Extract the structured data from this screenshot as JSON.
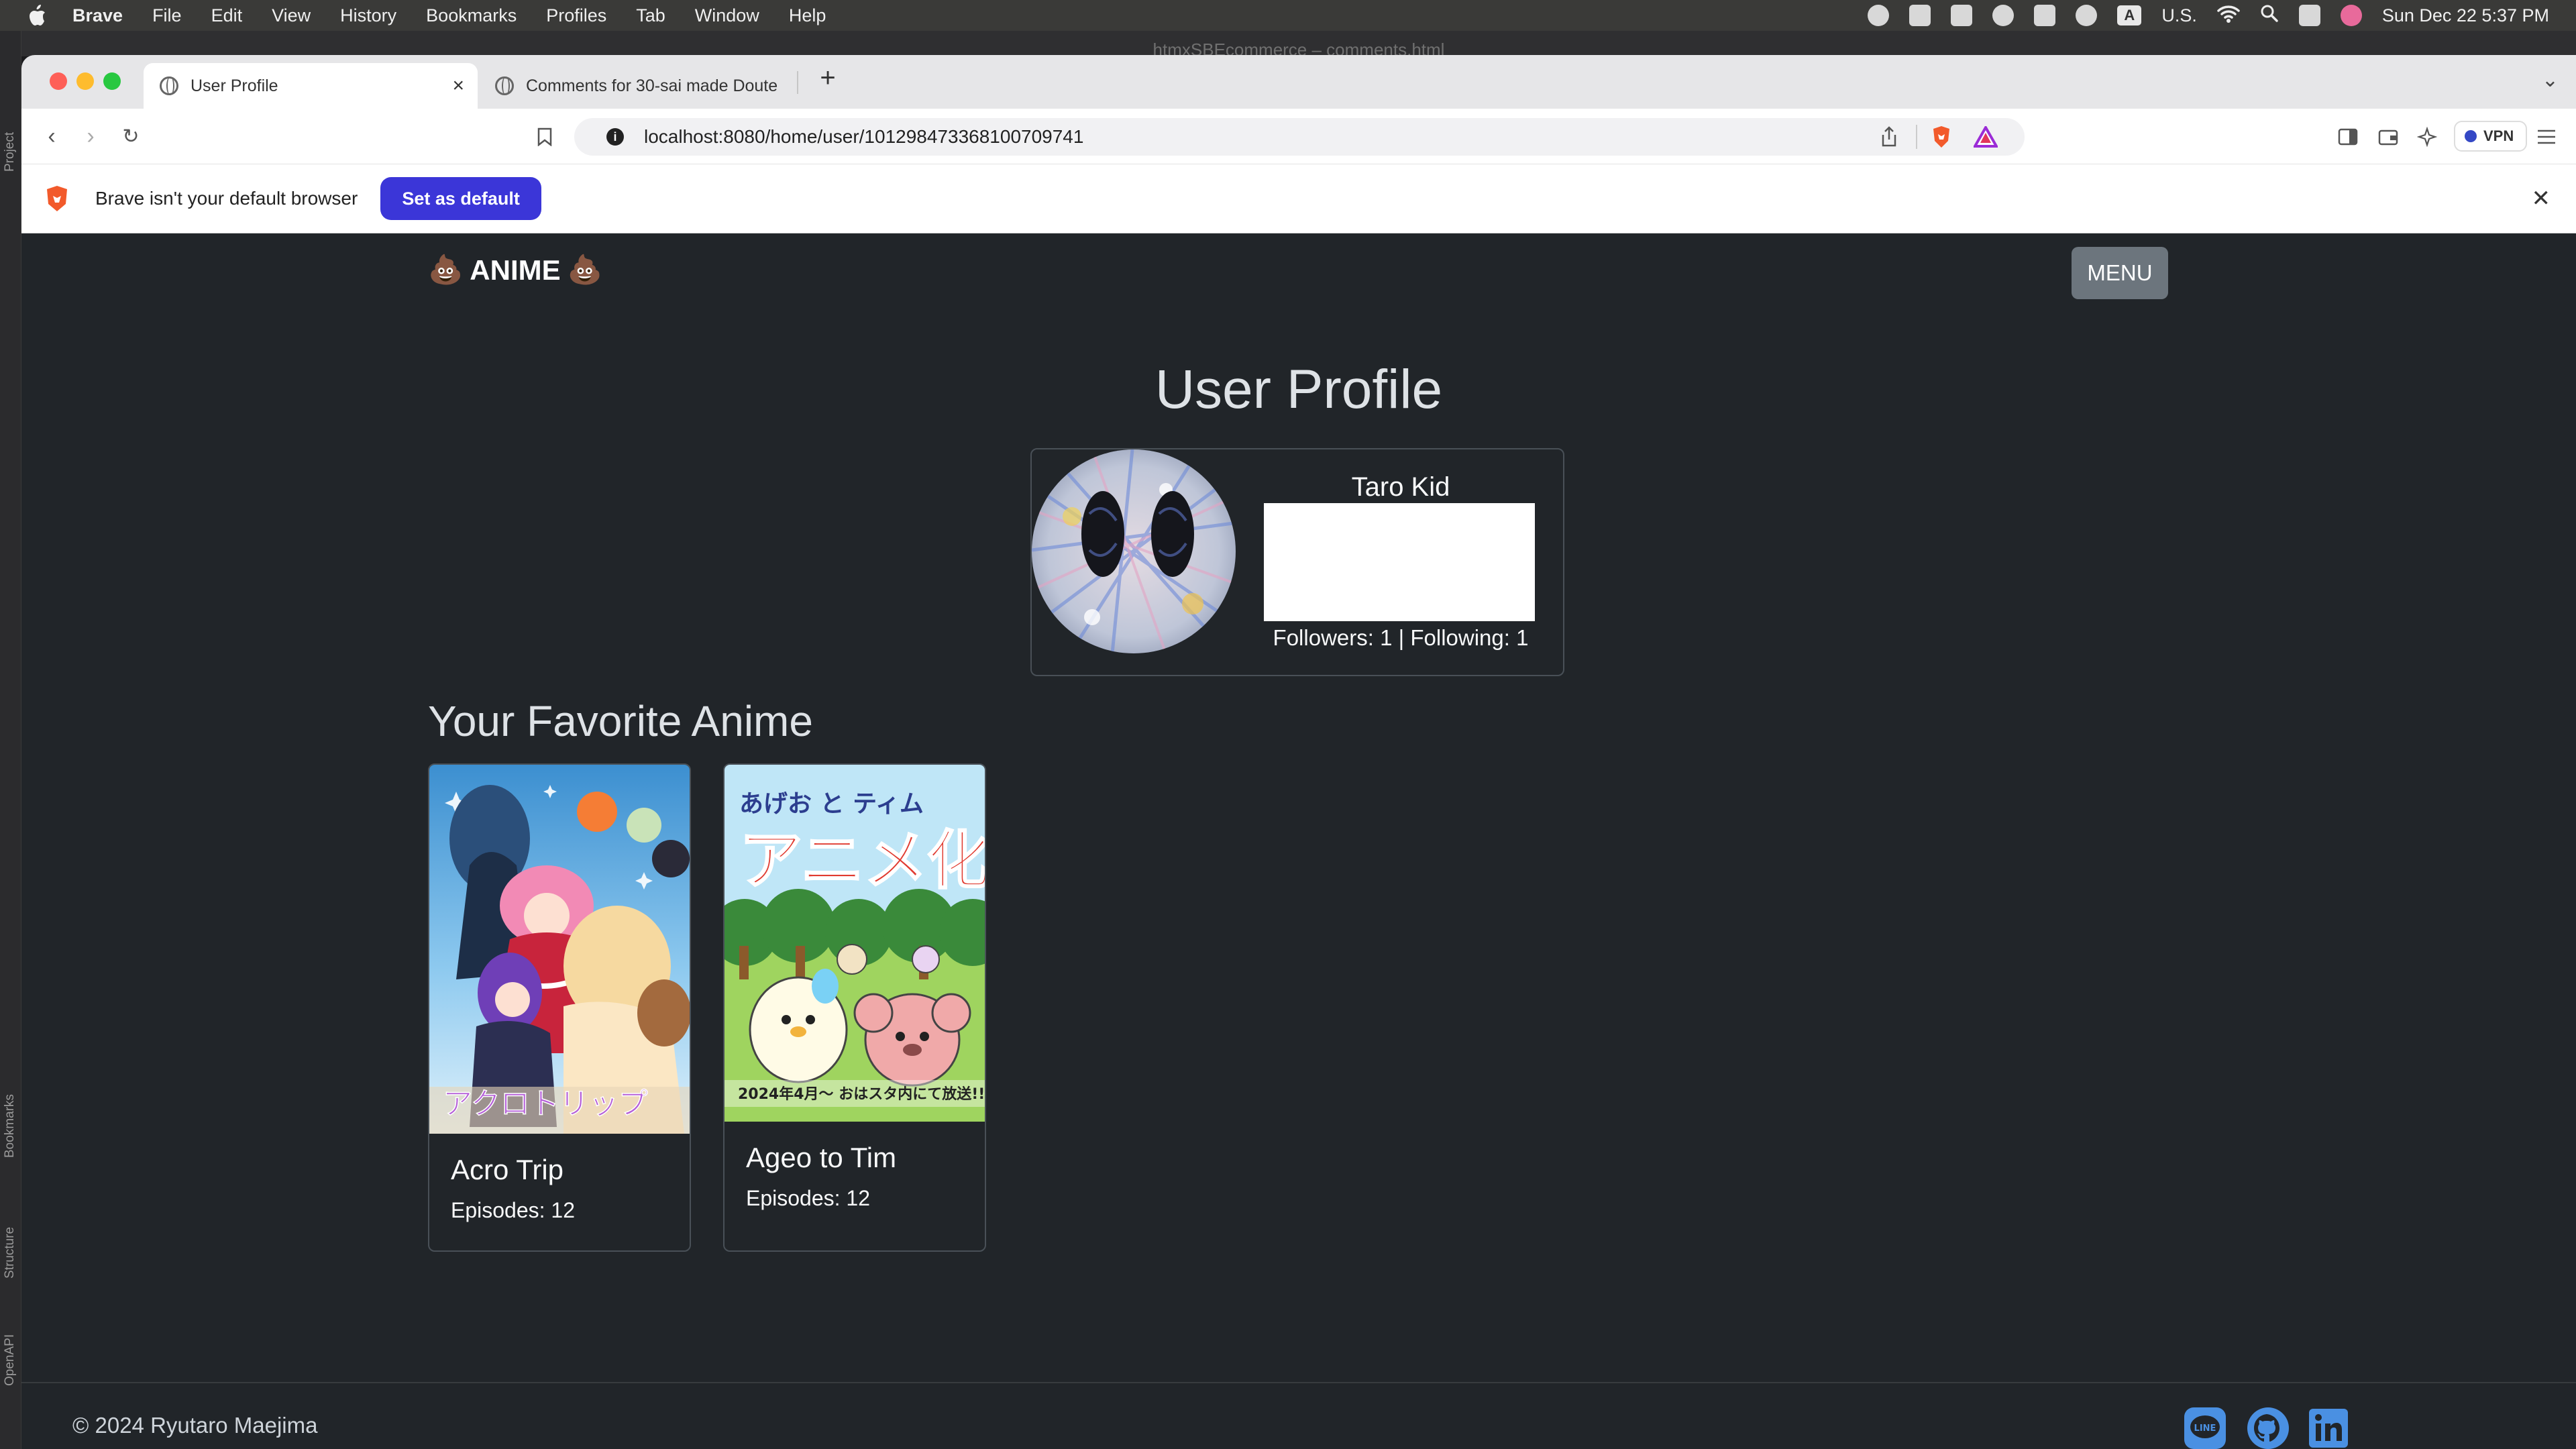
{
  "menubar": {
    "app": "Brave",
    "items": [
      "File",
      "Edit",
      "View",
      "History",
      "Bookmarks",
      "Profiles",
      "Tab",
      "Window",
      "Help"
    ],
    "input_source": "U.S.",
    "input_letter": "A",
    "datetime": "Sun Dec 22  5:37 PM"
  },
  "ide": {
    "window_title": "htmxSBEcommerce – comments.html",
    "side_labels": [
      "Project",
      "Bookmarks",
      "Structure",
      "OpenAPI"
    ]
  },
  "tabs": [
    {
      "title": "User Profile",
      "active": true
    },
    {
      "title": "Comments for 30-sai made Doute",
      "active": false
    }
  ],
  "address": {
    "url": "localhost:8080/home/user/101298473368100709741"
  },
  "toolbar": {
    "vpn_label": "VPN"
  },
  "infobar": {
    "message": "Brave isn't your default browser",
    "button": "Set as default"
  },
  "site": {
    "brand": "ANIME",
    "brand_emoji_left": "💩",
    "brand_emoji_right": "💩",
    "menu_button": "MENU"
  },
  "profile": {
    "page_title": "User Profile",
    "name": "Taro Kid",
    "stats": "Followers: 1 | Following: 1"
  },
  "favorites": {
    "heading": "Your Favorite Anime",
    "items": [
      {
        "title": "Acro Trip",
        "episodes": "Episodes: 12",
        "poster_caption": "アクロトリップ"
      },
      {
        "title": "Ageo to Tim",
        "episodes": "Episodes: 12",
        "poster_caption_top": "あげお と ティム",
        "poster_caption_main": "アニメ化",
        "poster_caption_bottom": "2024年4月〜 おはスタ内にて放送!!"
      }
    ]
  },
  "footer": {
    "copyright": "© 2024 Ryutaro Maejima",
    "social": [
      "line-icon",
      "github-icon",
      "linkedin-icon"
    ],
    "social_color": "#4a90e2"
  },
  "colors": {
    "page_bg": "#212529",
    "accent_button": "#3b36d8",
    "menu_button": "#6c757d"
  }
}
